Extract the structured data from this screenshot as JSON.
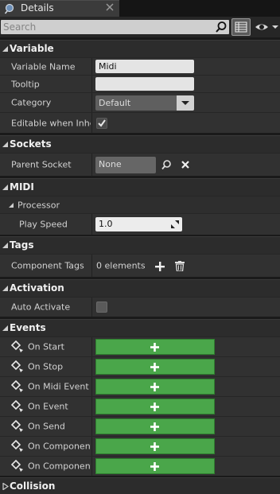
{
  "tab": {
    "title": "Details"
  },
  "search": {
    "placeholder": "Search"
  },
  "sections": {
    "variable": "Variable",
    "sockets": "Sockets",
    "midi": "MIDI",
    "tags": "Tags",
    "activation": "Activation",
    "events": "Events",
    "collision": "Collision"
  },
  "variable": {
    "name_label": "Variable Name",
    "name_value": "Midi",
    "tooltip_label": "Tooltip",
    "tooltip_value": "",
    "category_label": "Category",
    "category_value": "Default",
    "editable_label": "Editable when Inheri",
    "editable_checked": true
  },
  "sockets": {
    "parent_label": "Parent Socket",
    "parent_value": "None"
  },
  "midi": {
    "processor_label": "Processor",
    "play_speed_label": "Play Speed",
    "play_speed_value": "1.0"
  },
  "tags": {
    "component_tags_label": "Component Tags",
    "component_tags_value": "0 elements"
  },
  "activation": {
    "auto_activate_label": "Auto Activate",
    "auto_activate_checked": false
  },
  "events": [
    {
      "label": "On Start"
    },
    {
      "label": "On Stop"
    },
    {
      "label": "On Midi Event"
    },
    {
      "label": "On Event"
    },
    {
      "label": "On Send"
    },
    {
      "label": "On Component …"
    },
    {
      "label": "On Component I"
    }
  ],
  "colors": {
    "add_button": "#4aa64a",
    "panel_bg": "#313131",
    "section_bg": "#2c2c2c"
  }
}
